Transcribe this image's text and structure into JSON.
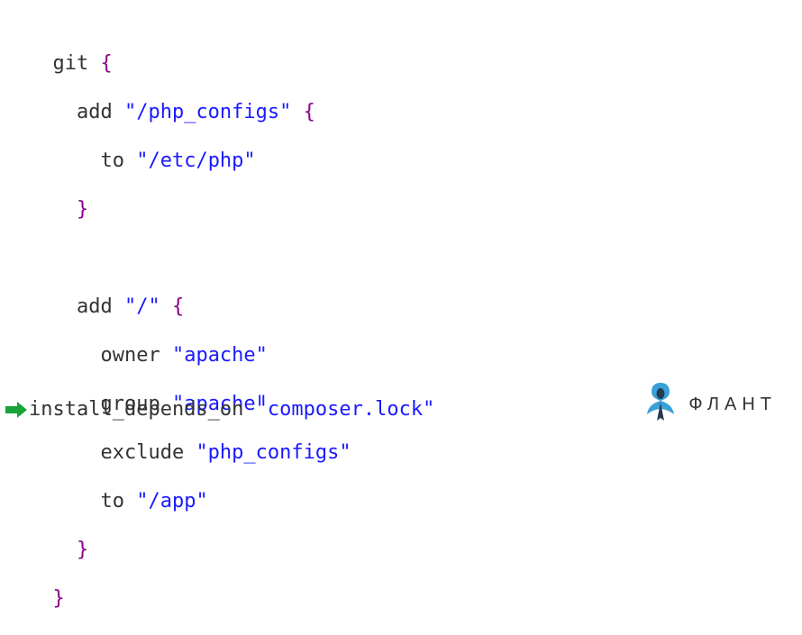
{
  "code": {
    "git_kw": "git",
    "add_kw": "add",
    "to_kw": "to",
    "owner_kw": "owner",
    "group_kw": "group",
    "exclude_kw": "exclude",
    "open_brace": "{",
    "close_brace": "}",
    "path_php_configs": "\"/php_configs\"",
    "path_etc_php": "\"/etc/php\"",
    "path_root": "\"/\"",
    "val_apache1": "\"apache\"",
    "val_apache2": "\"apache\"",
    "val_exclude": "\"php_configs\"",
    "path_app": "\"/app\"",
    "install_kw": "install_depends_on",
    "composer_lock": "\"composer.lock\""
  },
  "logo": {
    "text": "ФЛАНТ"
  },
  "colors": {
    "keyword": "#333333",
    "string": "#1a1aff",
    "brace": "#8b008b",
    "arrow": "#19a33a",
    "logo_blue": "#3aa0d8",
    "logo_dark": "#263a52"
  }
}
